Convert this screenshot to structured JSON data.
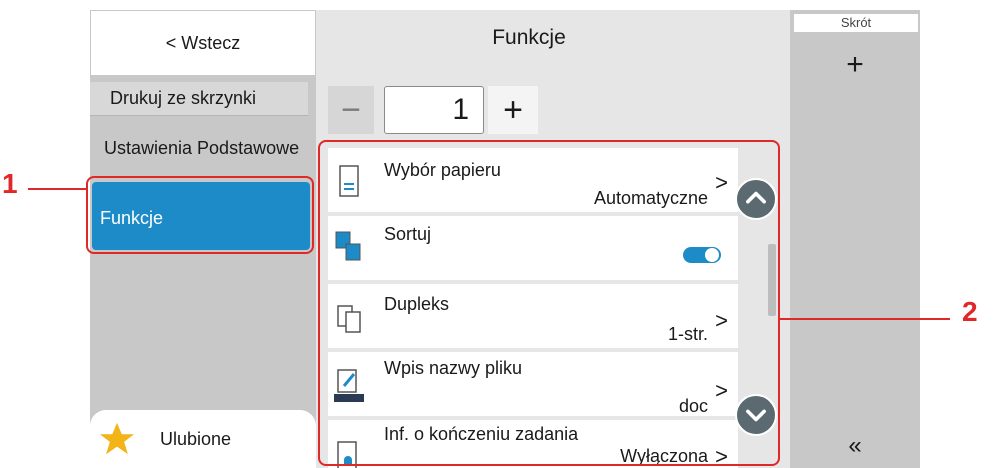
{
  "left": {
    "back_label": "< Wstecz",
    "box_title": "Drukuj ze skrzynki",
    "menu_basic": "Ustawienia Podstawowe",
    "menu_funkcje": "Funkcje",
    "favorites_label": "Ulubione",
    "favorites_icon": "star-icon"
  },
  "main": {
    "title": "Funkcje",
    "copies": {
      "minus": "−",
      "value": "1",
      "plus": "+"
    },
    "items": [
      {
        "label": "Wybór papieru",
        "value": "Automatyczne",
        "icon": "paper-icon"
      },
      {
        "label": "Sortuj",
        "value": "",
        "icon": "collate-icon",
        "toggle_on": true
      },
      {
        "label": "Dupleks",
        "value": "1-str.",
        "icon": "duplex-icon"
      },
      {
        "label": "Wpis nazwy pliku",
        "value": "doc",
        "icon": "file-name-icon"
      },
      {
        "label": "Inf. o kończeniu zadania",
        "value": "Wyłączona",
        "icon": "job-finish-notice-icon"
      }
    ]
  },
  "right": {
    "shortcut_label": "Skrót",
    "add_symbol": "+",
    "collapse_symbol": "«"
  },
  "callouts": {
    "one": "1",
    "two": "2"
  },
  "colors": {
    "accent": "#1d8bc8",
    "callout": "#e02828",
    "panel": "#c8c8c8"
  }
}
